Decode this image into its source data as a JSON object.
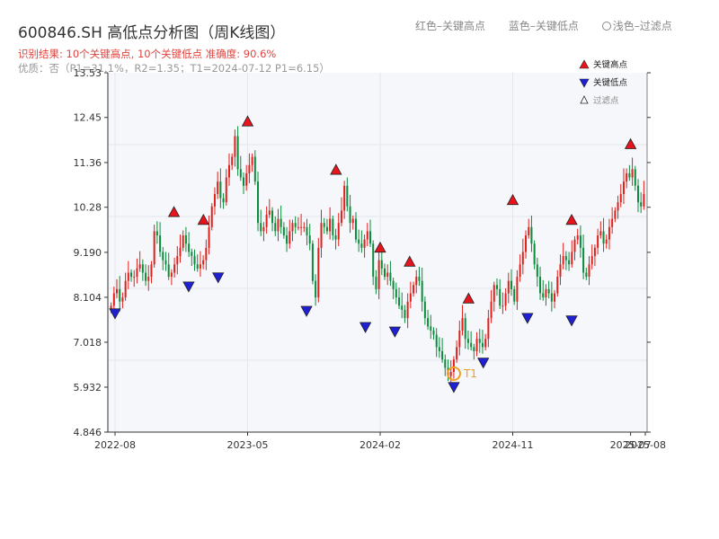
{
  "header": {
    "title": "600846.SH 高低点分析图（周K线图）",
    "legend_red": "红色–关键高点",
    "legend_blue": "蓝色–关键低点",
    "legend_light": "浅色–过滤点",
    "result": "识别结果: 10个关键高点, 10个关键低点   准确度: 90.6%",
    "quality": "优质：否（P1=31.1%，R2=1.35；T1=2024-07-12 P1=6.15）"
  },
  "chart_data": {
    "type": "candlestick",
    "ylim": [
      4.846,
      13.53
    ],
    "y_ticks": [
      "4.846",
      "5.932",
      "7.018",
      "8.104",
      "9.190",
      "10.28",
      "11.36",
      "12.45",
      "13.53"
    ],
    "x_ticks": [
      "2022-08",
      "2023-05",
      "2024-02",
      "2024-11",
      "2025-07",
      "2025-08"
    ],
    "colors": {
      "up": "#e0201c",
      "down": "#0a8c3c",
      "high_marker": "#e8141c",
      "low_marker": "#1f1fd6",
      "t1_ring": "#f0a020"
    },
    "legend": {
      "items": [
        "关键高点",
        "关键低点",
        "过滤点"
      ],
      "placement": "top-right"
    },
    "key_highs": [
      {
        "date": "2022-12",
        "value": 9.99
      },
      {
        "date": "2023-02",
        "value": 9.8
      },
      {
        "date": "2023-05",
        "value": 12.18
      },
      {
        "date": "2023-11",
        "value": 11.01
      },
      {
        "date": "2024-02",
        "value": 9.13
      },
      {
        "date": "2024-04",
        "value": 8.79
      },
      {
        "date": "2024-08",
        "value": 7.9
      },
      {
        "date": "2024-11",
        "value": 10.28
      },
      {
        "date": "2025-03",
        "value": 9.8
      },
      {
        "date": "2025-07",
        "value": 11.63
      }
    ],
    "key_lows": [
      {
        "date": "2022-08",
        "value": 7.89
      },
      {
        "date": "2023-01",
        "value": 8.54
      },
      {
        "date": "2023-03",
        "value": 8.76
      },
      {
        "date": "2023-09",
        "value": 7.95
      },
      {
        "date": "2024-01",
        "value": 7.56
      },
      {
        "date": "2024-03",
        "value": 7.45
      },
      {
        "date": "2024-07",
        "value": 6.11
      },
      {
        "date": "2024-09",
        "value": 6.7
      },
      {
        "date": "2024-12",
        "value": 7.78
      },
      {
        "date": "2025-03",
        "value": 7.72
      }
    ],
    "t1": {
      "label": "T1",
      "date": "2024-07",
      "value": 6.15
    },
    "close_series": [
      7.9,
      8.2,
      8.3,
      8.0,
      8.1,
      8.5,
      8.7,
      8.6,
      8.6,
      8.8,
      8.9,
      8.7,
      8.5,
      8.6,
      8.9,
      9.7,
      9.6,
      9.2,
      9.0,
      8.9,
      8.6,
      8.7,
      8.9,
      9.1,
      9.3,
      9.6,
      9.4,
      9.2,
      9.1,
      8.9,
      8.8,
      8.9,
      9.0,
      9.3,
      9.8,
      10.3,
      10.6,
      10.9,
      10.5,
      10.4,
      11.0,
      11.3,
      11.5,
      12.0,
      11.2,
      11.0,
      10.8,
      11.1,
      11.3,
      11.5,
      10.9,
      9.9,
      9.7,
      9.8,
      10.1,
      10.2,
      9.9,
      9.7,
      10.0,
      9.8,
      9.6,
      9.4,
      9.7,
      9.9,
      9.8,
      9.8,
      9.8,
      9.8,
      9.6,
      9.4,
      8.5,
      8.1,
      9.3,
      9.9,
      9.8,
      9.7,
      10.0,
      9.6,
      9.5,
      9.9,
      10.2,
      10.8,
      10.3,
      9.9,
      10.0,
      9.5,
      9.4,
      9.3,
      9.5,
      9.7,
      9.4,
      8.6,
      8.3,
      9.0,
      8.8,
      8.6,
      8.7,
      8.5,
      8.3,
      8.1,
      7.9,
      7.8,
      7.6,
      8.0,
      8.2,
      8.4,
      8.6,
      8.5,
      8.0,
      7.6,
      7.4,
      7.3,
      7.2,
      6.9,
      6.8,
      6.6,
      6.4,
      6.2,
      6.3,
      6.6,
      6.9,
      7.3,
      7.6,
      7.1,
      7.0,
      6.9,
      6.8,
      7.1,
      7.0,
      6.9,
      7.1,
      7.6,
      8.0,
      8.4,
      8.3,
      7.9,
      7.9,
      8.2,
      8.5,
      8.3,
      8.0,
      8.6,
      8.9,
      9.2,
      9.6,
      9.8,
      9.4,
      8.9,
      8.6,
      8.2,
      8.1,
      8.3,
      8.2,
      8.0,
      8.2,
      8.6,
      8.9,
      9.1,
      9.0,
      8.9,
      9.2,
      9.5,
      9.6,
      9.3,
      8.7,
      8.6,
      8.9,
      9.1,
      9.3,
      9.6,
      9.7,
      9.4,
      9.5,
      9.8,
      10.0,
      10.2,
      10.4,
      10.6,
      10.9,
      11.1,
      11.0,
      11.2,
      10.8,
      10.4,
      10.3,
      10.6
    ]
  }
}
